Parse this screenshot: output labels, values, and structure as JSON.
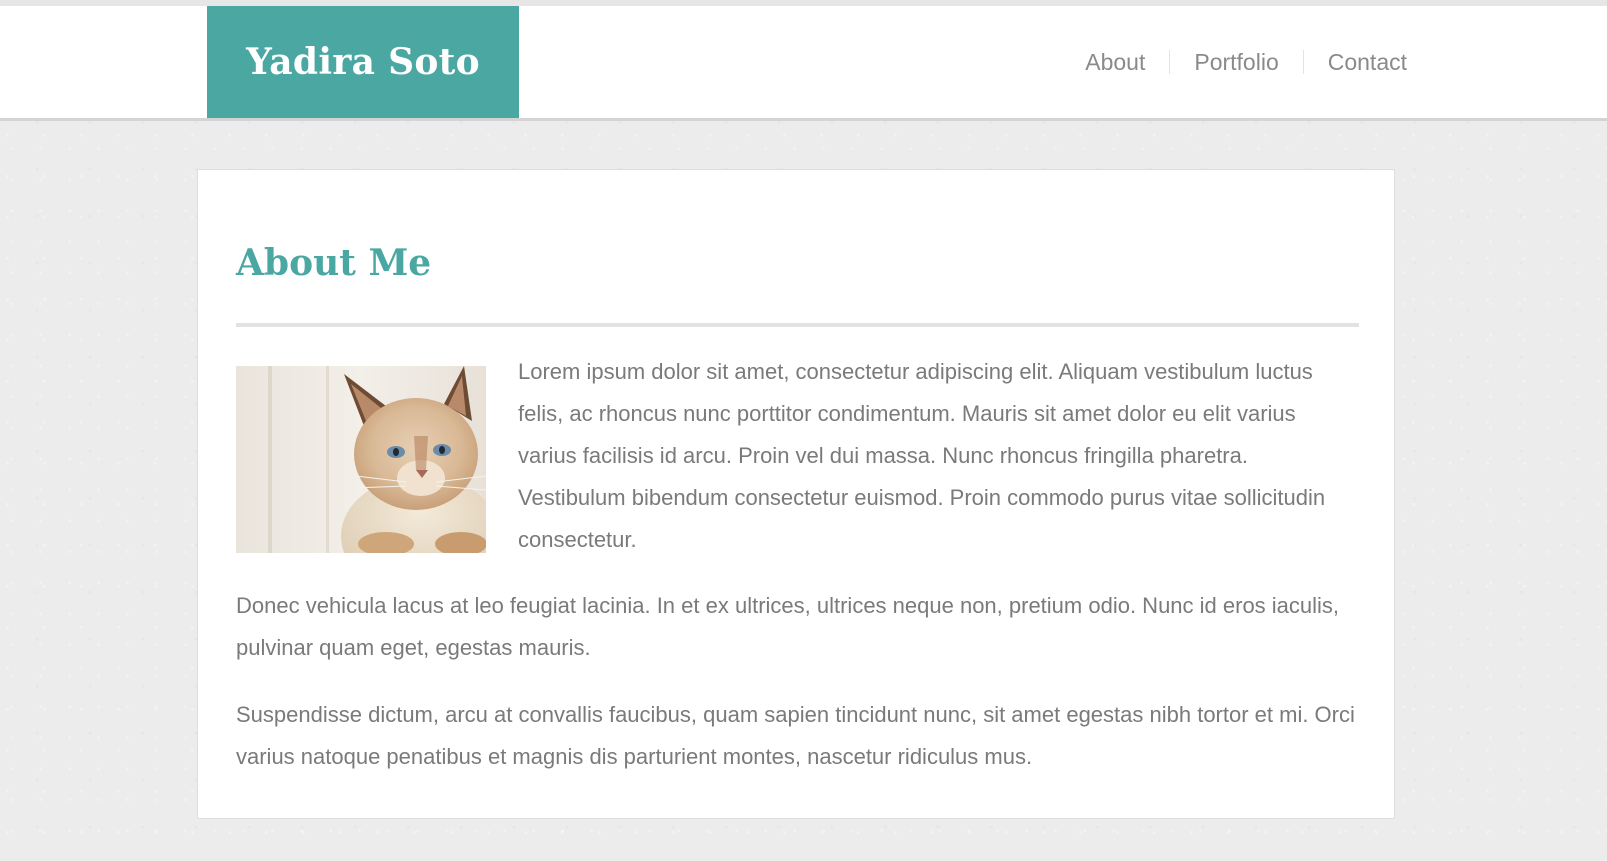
{
  "site": {
    "name": "Yadira Soto"
  },
  "nav": {
    "items": [
      {
        "label": "About"
      },
      {
        "label": "Portfolio"
      },
      {
        "label": "Contact"
      }
    ]
  },
  "main": {
    "title": "About Me",
    "paragraphs": [
      "Lorem ipsum dolor sit amet, consectetur adipiscing elit. Aliquam vestibulum luctus felis, ac rhoncus nunc porttitor condimentum. Mauris sit amet dolor eu elit varius varius facilisis id arcu. Proin vel dui massa. Nunc rhoncus fringilla pharetra. Vestibulum bibendum consectetur euismod. Proin commodo purus vitae sollicitudin consectetur.",
      "Donec vehicula lacus at leo feugiat lacinia. In et ex ultrices, ultrices neque non, pretium odio. Nunc id eros iaculis, pulvinar quam eget, egestas mauris.",
      "Suspendisse dictum, arcu at convallis faucibus, quam sapien tincidunt nunc, sit amet egestas nibh tortor et mi. Orci varius natoque penatibus et magnis dis parturient montes, nascetur ridiculus mus."
    ]
  },
  "colors": {
    "accent": "#4aa7a2",
    "text": "#7a7a7a",
    "nav_text": "#8a8a8a",
    "background": "#ececec"
  }
}
